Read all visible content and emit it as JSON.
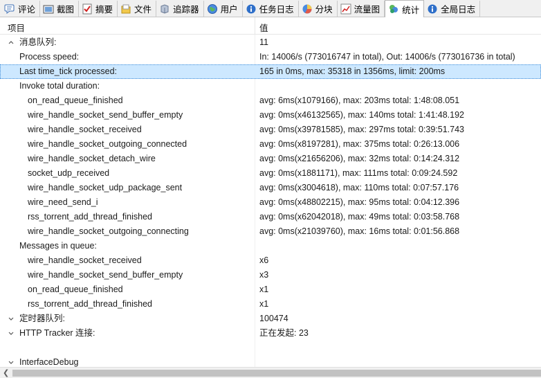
{
  "tabs": [
    {
      "label": "评论",
      "icon": "comment-icon",
      "active": false
    },
    {
      "label": "截图",
      "icon": "screenshot-icon",
      "active": false
    },
    {
      "label": "摘要",
      "icon": "summary-check-icon",
      "active": false
    },
    {
      "label": "文件",
      "icon": "file-icon",
      "active": false
    },
    {
      "label": "追踪器",
      "icon": "tracker-icon",
      "active": false
    },
    {
      "label": "用户",
      "icon": "peers-globe-icon",
      "active": false
    },
    {
      "label": "任务日志",
      "icon": "info-icon",
      "active": false
    },
    {
      "label": "分块",
      "icon": "pie-icon",
      "active": false
    },
    {
      "label": "流量图",
      "icon": "chart-icon",
      "active": false
    },
    {
      "label": "统计",
      "icon": "stats-icon",
      "active": true
    },
    {
      "label": "全局日志",
      "icon": "info-icon",
      "active": false
    }
  ],
  "header": {
    "col_item": "项目",
    "col_value": "值"
  },
  "rows": [
    {
      "level": 0,
      "expanded": true,
      "name": "消息队列:",
      "value": "11"
    },
    {
      "level": 1,
      "name": "Process speed:",
      "value": "In: 14006/s (773016747 in total), Out: 14006/s (773016736 in total)"
    },
    {
      "level": 1,
      "name": "Last time_tick processed:",
      "value": "165 in 0ms, max: 35318 in 1356ms, limit: 200ms",
      "selected": true
    },
    {
      "level": 1,
      "name": "Invoke total duration:",
      "value": ""
    },
    {
      "level": 2,
      "name": "on_read_queue_finished",
      "value": "avg: 6ms(x1079166), max: 203ms total: 1:48:08.051"
    },
    {
      "level": 2,
      "name": "wire_handle_socket_send_buffer_empty",
      "value": "avg: 0ms(x46132565), max: 140ms total: 1:41:48.192"
    },
    {
      "level": 2,
      "name": "wire_handle_socket_received",
      "value": "avg: 0ms(x39781585), max: 297ms total: 0:39:51.743"
    },
    {
      "level": 2,
      "name": "wire_handle_socket_outgoing_connected",
      "value": "avg: 0ms(x8197281), max: 375ms total: 0:26:13.006"
    },
    {
      "level": 2,
      "name": "wire_handle_socket_detach_wire",
      "value": "avg: 0ms(x21656206), max: 32ms total: 0:14:24.312"
    },
    {
      "level": 2,
      "name": "socket_udp_received",
      "value": "avg: 0ms(x1881171), max: 111ms total: 0:09:24.592"
    },
    {
      "level": 2,
      "name": "wire_handle_socket_udp_package_sent",
      "value": "avg: 0ms(x3004618), max: 110ms total: 0:07:57.176"
    },
    {
      "level": 2,
      "name": "wire_need_send_i",
      "value": "avg: 0ms(x48802215), max: 95ms total: 0:04:12.396"
    },
    {
      "level": 2,
      "name": "rss_torrent_add_thread_finished",
      "value": "avg: 0ms(x62042018), max: 49ms total: 0:03:58.768"
    },
    {
      "level": 2,
      "name": "wire_handle_socket_outgoing_connecting",
      "value": "avg: 0ms(x21039760), max: 16ms total: 0:01:56.868"
    },
    {
      "level": 1,
      "name": "Messages in queue:",
      "value": ""
    },
    {
      "level": 2,
      "name": "wire_handle_socket_received",
      "value": "x6"
    },
    {
      "level": 2,
      "name": "wire_handle_socket_send_buffer_empty",
      "value": "x3"
    },
    {
      "level": 2,
      "name": "on_read_queue_finished",
      "value": "x1"
    },
    {
      "level": 2,
      "name": "rss_torrent_add_thread_finished",
      "value": "x1"
    },
    {
      "level": 0,
      "expanded": false,
      "name": "定时器队列:",
      "value": "100474"
    },
    {
      "level": 0,
      "expanded": false,
      "name": "HTTP Tracker 连接:",
      "value": "正在发起: 23"
    },
    {
      "level": -1,
      "name": "",
      "value": ""
    },
    {
      "level": 0,
      "expanded": false,
      "name": "InterfaceDebug",
      "value": ""
    }
  ]
}
